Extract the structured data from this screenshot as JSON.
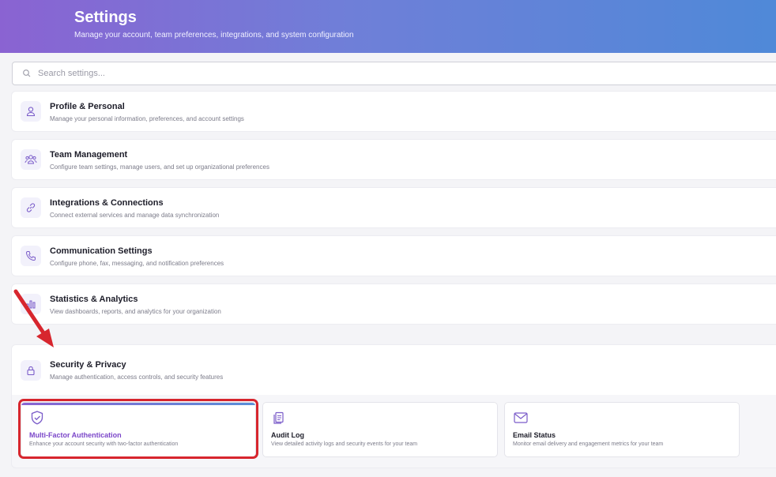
{
  "header": {
    "title": "Settings",
    "subtitle": "Manage your account, team preferences, integrations, and system configuration"
  },
  "search": {
    "placeholder": "Search settings..."
  },
  "sections": [
    {
      "title": "Profile & Personal",
      "description": "Manage your personal information, preferences, and account settings",
      "icon": "user-icon"
    },
    {
      "title": "Team Management",
      "description": "Configure team settings, manage users, and set up organizational preferences",
      "icon": "team-icon"
    },
    {
      "title": "Integrations & Connections",
      "description": "Connect external services and manage data synchronization",
      "icon": "link-icon"
    },
    {
      "title": "Communication Settings",
      "description": "Configure phone, fax, messaging, and notification preferences",
      "icon": "phone-icon"
    },
    {
      "title": "Statistics & Analytics",
      "description": "View dashboards, reports, and analytics for your organization",
      "icon": "bar-chart-icon"
    }
  ],
  "security": {
    "title": "Security & Privacy",
    "description": "Manage authentication, access controls, and security features",
    "icon": "lock-icon",
    "items": [
      {
        "title": "Multi-Factor Authentication",
        "description": "Enhance your account security with two-factor authentication",
        "icon": "shield-check-icon",
        "active": true
      },
      {
        "title": "Audit Log",
        "description": "View detailed activity logs and security events for your team",
        "icon": "clipboard-icon",
        "active": false
      },
      {
        "title": "Email Status",
        "description": "Monitor email delivery and engagement metrics for your team",
        "icon": "mail-icon",
        "active": false
      }
    ]
  },
  "colors": {
    "accent": "#7b46c9",
    "highlight": "#d7262e",
    "icon": "#7a5bc9"
  }
}
